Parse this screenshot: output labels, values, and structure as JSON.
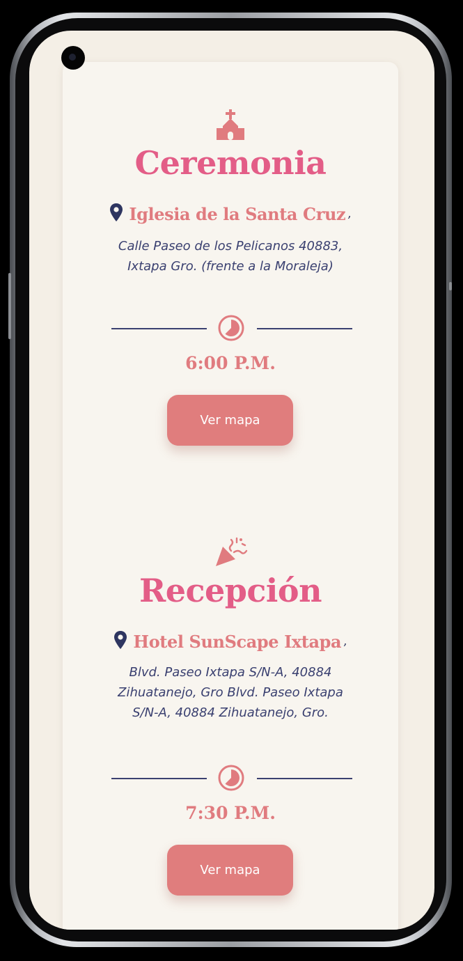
{
  "ceremony": {
    "icon": "church-icon",
    "title": "Ceremonia",
    "venue_name": "Iglesia de la Santa Cruz",
    "venue_suffix": ",",
    "address": "Calle  Paseo de los  Pelicanos 40883,  Ixtapa Gro. (frente a la Moraleja)",
    "time": "6:00 P.M.",
    "map_button_label": "Ver mapa"
  },
  "reception": {
    "icon": "party-popper-icon",
    "title": "Recepción",
    "venue_name": "Hotel SunScape Ixtapa",
    "venue_suffix": " ,",
    "address": "Blvd.  Paseo  Ixtapa S/N-A, 40884 Zihuatanejo, Gro  Blvd.  Paseo Ixtapa S/N-A, 40884 Zihuatanejo, Gro.",
    "time": "7:30 P.M.",
    "map_button_label": "Ver mapa"
  },
  "colors": {
    "title_pink": "#e35d87",
    "accent_coral": "#e07b7f",
    "navy": "#3a4070",
    "background": "#f4efe6",
    "card": "#f8f5ef"
  }
}
